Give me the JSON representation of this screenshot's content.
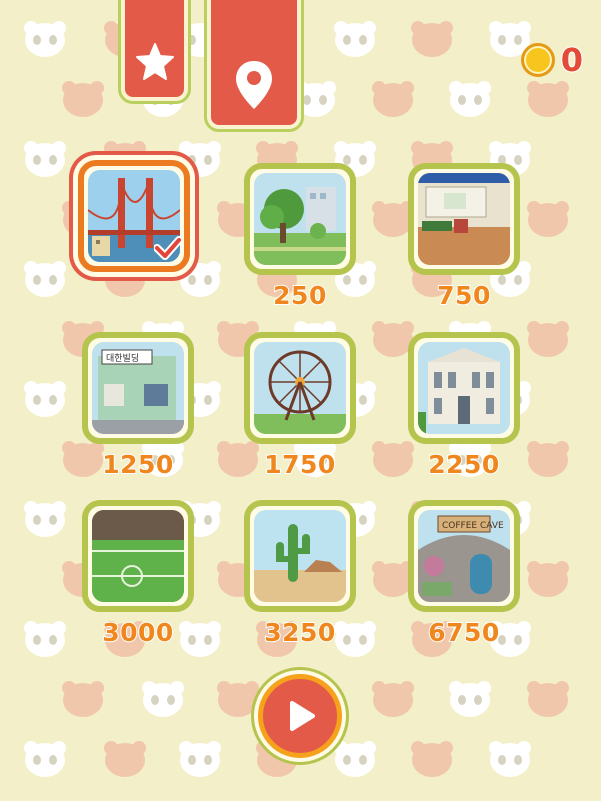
{
  "coins": {
    "count": "0"
  },
  "colors": {
    "background": "#f3efc8",
    "accent_red": "#e35a48",
    "frame_green": "#b5c44c",
    "price_orange": "#f0861e",
    "selected_orange": "#ec7a20"
  },
  "top_tabs": [
    {
      "name": "favorites-tab",
      "icon": "star-icon"
    },
    {
      "name": "locations-tab",
      "icon": "map-pin-icon"
    }
  ],
  "levels": [
    {
      "id": "golden-gate",
      "scene": "bridge",
      "price": "",
      "selected": true,
      "unlocked": true
    },
    {
      "id": "park",
      "scene": "park",
      "price": "250",
      "selected": false
    },
    {
      "id": "market-stall",
      "scene": "stall",
      "price": "750",
      "selected": false
    },
    {
      "id": "korean-building",
      "scene": "building",
      "price": "1250",
      "selected": false
    },
    {
      "id": "ferris-wheel",
      "scene": "ferris",
      "price": "1750",
      "selected": false
    },
    {
      "id": "museum",
      "scene": "museum",
      "price": "2250",
      "selected": false
    },
    {
      "id": "stadium",
      "scene": "stadium",
      "price": "3000",
      "selected": false
    },
    {
      "id": "desert",
      "scene": "desert",
      "price": "3250",
      "selected": false
    },
    {
      "id": "coffee-cave",
      "scene": "cafe",
      "price": "6750",
      "selected": false
    }
  ],
  "play_button": {
    "icon": "play-icon"
  }
}
